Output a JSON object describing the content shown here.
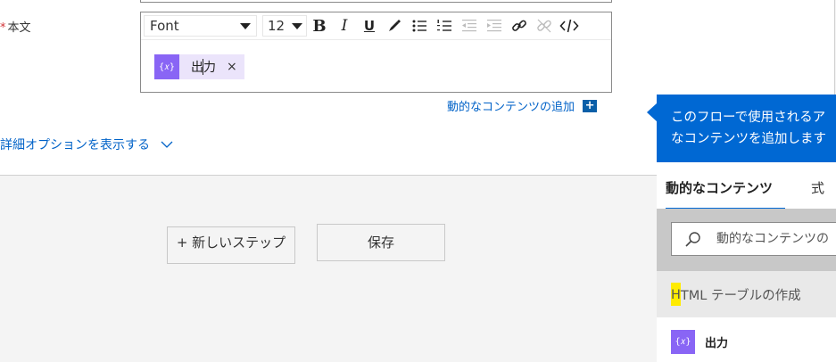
{
  "form": {
    "required_mark": "*",
    "body_label": "本文",
    "add_dynamic_link": "動的なコンテンツの追加",
    "add_dynamic_plus": "+",
    "advanced_link": "詳細オプションを表示する"
  },
  "toolbar": {
    "font_value": "Font",
    "size_value": "12",
    "bold": "B",
    "italic": "I",
    "underline": "U"
  },
  "token": {
    "icon_text": "{𝑥}",
    "label": "出力",
    "close": "×"
  },
  "buttons": {
    "new_step": "+ 新しいステップ",
    "save": "保存"
  },
  "panel": {
    "header_line1": "このフローで使用されるア",
    "header_line2": "なコンテンツを追加します",
    "tab_dynamic": "動的なコンテンツ",
    "tab_expression": "式",
    "search_placeholder": "動的なコンテンツの",
    "section_highlight": "H",
    "section_rest": "TML テーブルの作成",
    "item_icon_text": "{𝑥}",
    "item_label": "出力"
  },
  "colors": {
    "accent": "#0068d3",
    "link": "#0062c8",
    "token_bg": "#ebe4fb",
    "token_icon": "#8965f5",
    "highlight": "#ffeb00"
  }
}
